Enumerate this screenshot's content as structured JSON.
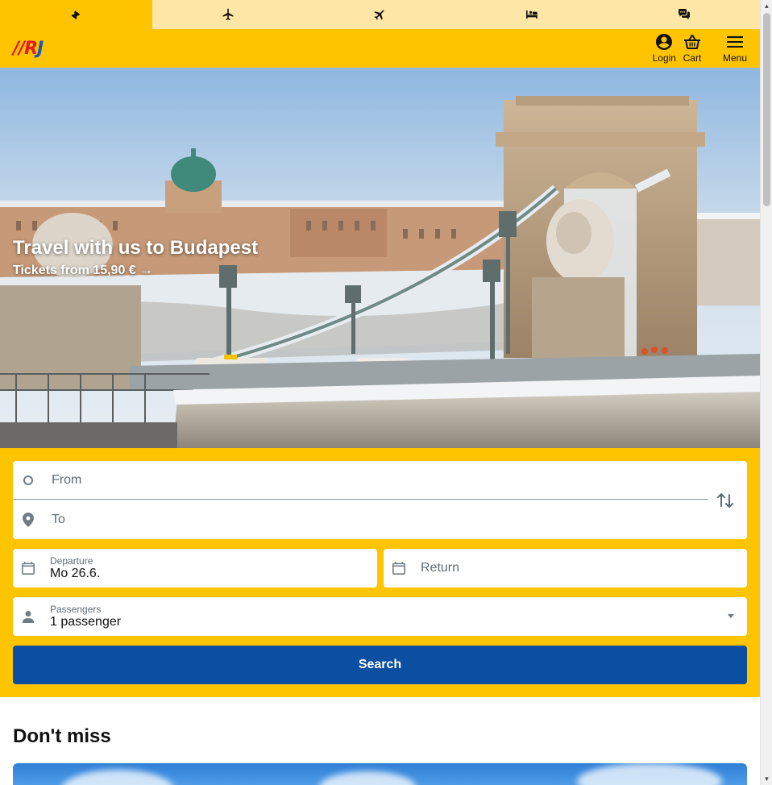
{
  "product_tabs": [
    {
      "name": "train-tickets",
      "icon": "ticket-icon",
      "active": true
    },
    {
      "name": "flights",
      "icon": "airplane-icon",
      "active": false
    },
    {
      "name": "flights-alt",
      "icon": "airplane-alt-icon",
      "active": false
    },
    {
      "name": "accommodation",
      "icon": "bed-icon",
      "active": false
    },
    {
      "name": "chat",
      "icon": "chat-icon",
      "active": false
    }
  ],
  "header": {
    "logo": {
      "bars": "//",
      "r": "R",
      "j": "J"
    },
    "login_label": "Login",
    "cart_label": "Cart",
    "menu_label": "Menu"
  },
  "hero": {
    "title": "Travel with us to Budapest",
    "subtitle": "Tickets from 15,90 €",
    "arrow": "→"
  },
  "search": {
    "from_placeholder": "From",
    "to_placeholder": "To",
    "departure_label": "Departure",
    "departure_value": "Mo 26.6.",
    "return_placeholder": "Return",
    "passengers_label": "Passengers",
    "passengers_value": "1 passenger",
    "search_label": "Search"
  },
  "dont_miss": {
    "title": "Don't miss"
  },
  "colors": {
    "brand_yellow": "#ffc400",
    "tab_inactive": "#fee6a6",
    "primary_blue": "#0b4ea2"
  }
}
